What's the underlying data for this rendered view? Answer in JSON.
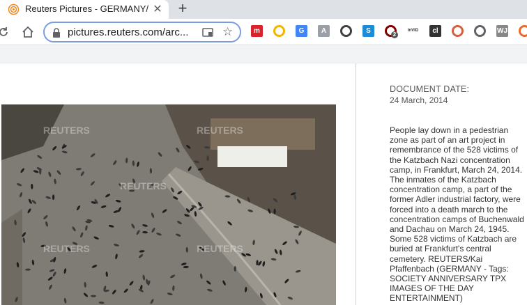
{
  "browser": {
    "tab_title": "Reuters Pictures - GERMANY/",
    "url_display": "pictures.reuters.com/arc...",
    "extensions": [
      {
        "name": "mendeley",
        "label": "m",
        "color": "#d9232d"
      },
      {
        "name": "bookmark",
        "label": "",
        "color": "#f4b400"
      },
      {
        "name": "translate",
        "label": "G",
        "color": "#4285f4"
      },
      {
        "name": "gray-a",
        "label": "A",
        "color": "#9aa0a6"
      },
      {
        "name": "download",
        "label": "",
        "color": "#3c4043"
      },
      {
        "name": "skype",
        "label": "S",
        "color": "#1a8cd8"
      },
      {
        "name": "ublock",
        "label": "",
        "color": "#800000",
        "badge": "2"
      },
      {
        "name": "invid",
        "label": "InVID",
        "color": "#333333"
      },
      {
        "name": "cl",
        "label": "cl",
        "color": "#333333"
      },
      {
        "name": "globe",
        "label": "",
        "color": "#d55f3f"
      },
      {
        "name": "drive",
        "label": "",
        "color": "#5f6368"
      },
      {
        "name": "wj",
        "label": "WJ",
        "color": "#888888"
      },
      {
        "name": "audio",
        "label": "",
        "color": "#ea6a2a"
      }
    ]
  },
  "document": {
    "date_label": "DOCUMENT DATE:",
    "date_value": "24 March, 2014",
    "caption": "People lay down in a pedestrian zone as part of an art project in remembrance of the 528 victims of the Katzbach Nazi concentration camp, in Frankfurt, March 24, 2014. The inmates of the Katzbach concentration camp, a part of the former Adler industrial factory, were forced into a death march to the concentration camps of Buchenwald and Dachau on March 24, 1945. Some 528 victims of Katzbach are buried at Frankfurt's central cemetery. REUTERS/Kai Pfaffenbach (GERMANY - Tags: SOCIETY ANNIVERSARY TPX IMAGES OF THE DAY ENTERTAINMENT)"
  },
  "photo": {
    "watermark": "REUTERS"
  }
}
